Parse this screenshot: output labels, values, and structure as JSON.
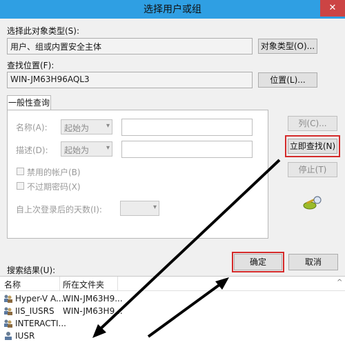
{
  "window": {
    "title": "选择用户或组",
    "close_glyph": "✕"
  },
  "object_type": {
    "label": "选择此对象类型(S):",
    "value": "用户、组或内置安全主体",
    "button": "对象类型(O)..."
  },
  "location": {
    "label": "查找位置(F):",
    "value": "WIN-JM63H96AQL3",
    "button": "位置(L)..."
  },
  "tab": {
    "label": "一般性查询"
  },
  "query": {
    "name_label": "名称(A):",
    "name_mode": "起始为",
    "desc_label": "描述(D):",
    "desc_mode": "起始为",
    "disabled_accounts": "禁用的帐户(B)",
    "non_expiring": "不过期密码(X)",
    "days_label": "自上次登录后的天数(I):"
  },
  "buttons": {
    "columns": "列(C)...",
    "find_now": "立即查找(N)",
    "stop": "停止(T)",
    "ok": "确定",
    "cancel": "取消"
  },
  "results": {
    "label": "搜索结果(U):",
    "headers": [
      "名称",
      "所在文件夹"
    ],
    "rows": [
      {
        "name": "Hyper-V A...",
        "folder": "WIN-JM63H9..."
      },
      {
        "name": "IIS_IUSRS",
        "folder": "WIN-JM63H9..."
      },
      {
        "name": "INTERACTI...",
        "folder": ""
      },
      {
        "name": "IUSR",
        "folder": ""
      }
    ],
    "sort_glyph": "^"
  },
  "colors": {
    "titlebar": "#2f9fe3",
    "highlight": "#d42a2a",
    "arrow": "#000000"
  }
}
